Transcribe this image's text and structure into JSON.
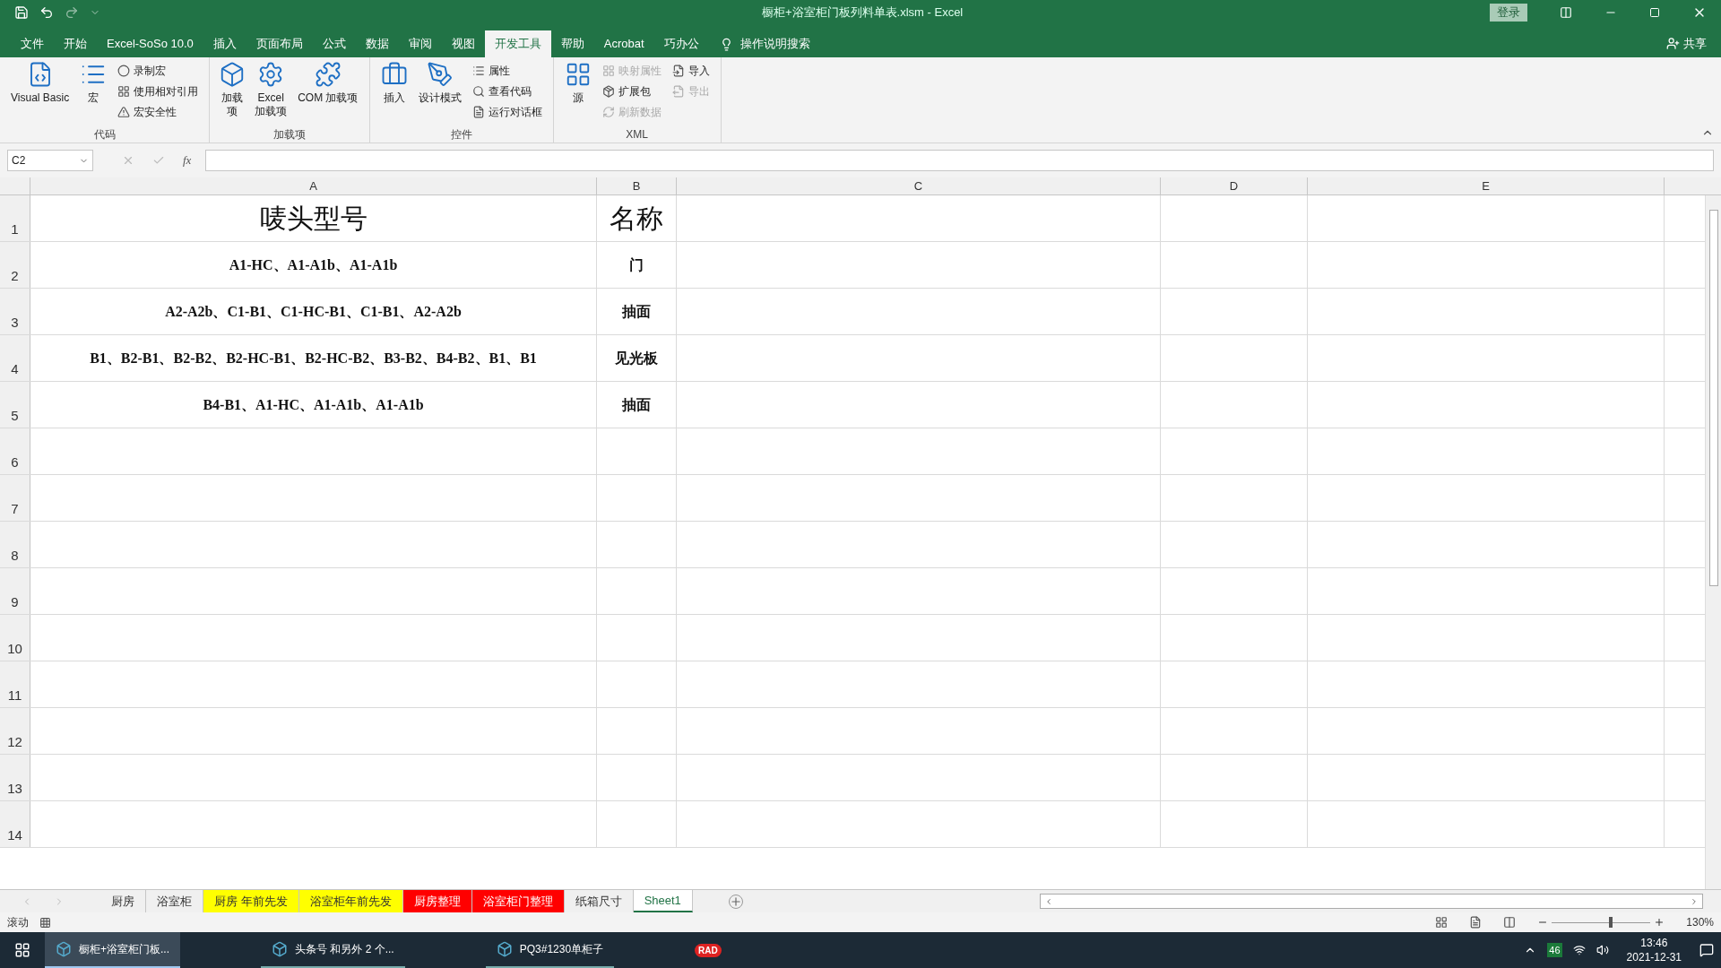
{
  "window": {
    "title": "橱柜+浴室柜门板列料单表.xlsm  -  Excel",
    "login": "登录"
  },
  "menu_tabs": [
    {
      "label": "文件",
      "selected": false
    },
    {
      "label": "开始",
      "selected": false
    },
    {
      "label": "Excel-SoSo 10.0",
      "selected": false
    },
    {
      "label": "插入",
      "selected": false
    },
    {
      "label": "页面布局",
      "selected": false
    },
    {
      "label": "公式",
      "selected": false
    },
    {
      "label": "数据",
      "selected": false
    },
    {
      "label": "审阅",
      "selected": false
    },
    {
      "label": "视图",
      "selected": false
    },
    {
      "label": "开发工具",
      "selected": true
    },
    {
      "label": "帮助",
      "selected": false
    },
    {
      "label": "Acrobat",
      "selected": false
    },
    {
      "label": "巧办公",
      "selected": false
    }
  ],
  "tell_me": "操作说明搜索",
  "share": "共享",
  "ribbon_groups": [
    {
      "label": "代码",
      "items": [
        {
          "kind": "large",
          "label": "Visual Basic",
          "disabled": false
        },
        {
          "kind": "large",
          "label": "宏",
          "disabled": false
        },
        {
          "kind": "small",
          "label": "录制宏",
          "disabled": false
        },
        {
          "kind": "small",
          "label": "使用相对引用",
          "disabled": false
        },
        {
          "kind": "small",
          "label": "宏安全性",
          "disabled": false
        }
      ]
    },
    {
      "label": "加载项",
      "items": [
        {
          "kind": "large",
          "label": "加载项",
          "disabled": false
        },
        {
          "kind": "large",
          "label": "Excel\n加载项",
          "disabled": false
        },
        {
          "kind": "large",
          "label": "COM 加载项",
          "disabled": false
        }
      ]
    },
    {
      "label": "控件",
      "items": [
        {
          "kind": "large",
          "label": "插入",
          "disabled": false
        },
        {
          "kind": "large",
          "label": "设计模式",
          "disabled": false
        },
        {
          "kind": "small",
          "label": "属性",
          "disabled": false
        },
        {
          "kind": "small",
          "label": "查看代码",
          "disabled": false
        },
        {
          "kind": "small",
          "label": "运行对话框",
          "disabled": false
        }
      ]
    },
    {
      "label": "XML",
      "items": [
        {
          "kind": "large",
          "label": "源",
          "disabled": false
        },
        {
          "kind": "small",
          "label": "映射属性",
          "disabled": true
        },
        {
          "kind": "small",
          "label": "扩展包",
          "disabled": false
        },
        {
          "kind": "small",
          "label": "刷新数据",
          "disabled": true
        },
        {
          "kind": "small",
          "label": "导入",
          "disabled": false
        },
        {
          "kind": "small",
          "label": "导出",
          "disabled": true
        }
      ]
    }
  ],
  "name_box": "C2",
  "formula_label": "fx",
  "columns": [
    "A",
    "B",
    "C",
    "D",
    "E"
  ],
  "rows": [
    {
      "number": "1",
      "cells": [
        "唛头型号",
        "名称"
      ]
    },
    {
      "number": "2",
      "cells": [
        "A1-HC、A1-A1b、A1-A1b",
        "门"
      ]
    },
    {
      "number": "3",
      "cells": [
        "A2-A2b、C1-B1、C1-HC-B1、C1-B1、A2-A2b",
        "抽面"
      ]
    },
    {
      "number": "4",
      "cells": [
        "B1、B2-B1、B2-B2、B2-HC-B1、B2-HC-B2、B3-B2、B4-B2、B1、B1",
        "见光板"
      ]
    },
    {
      "number": "5",
      "cells": [
        "B4-B1、A1-HC、A1-A1b、A1-A1b",
        "抽面"
      ]
    },
    {
      "number": "6",
      "cells": []
    },
    {
      "number": "7",
      "cells": []
    },
    {
      "number": "8",
      "cells": []
    },
    {
      "number": "9",
      "cells": []
    },
    {
      "number": "10",
      "cells": []
    },
    {
      "number": "11",
      "cells": []
    },
    {
      "number": "12",
      "cells": []
    },
    {
      "number": "13",
      "cells": []
    },
    {
      "number": "14",
      "cells": []
    }
  ],
  "sheet_tabs": [
    {
      "label": "厨房",
      "color": "#f0f0f0",
      "selected": false
    },
    {
      "label": "浴室柜",
      "color": "#f0f0f0",
      "selected": false
    },
    {
      "label": "厨房 年前先发",
      "color": "#ffff00",
      "selected": false
    },
    {
      "label": "浴室柜年前先发",
      "color": "#ffff00",
      "selected": false
    },
    {
      "label": "厨房整理",
      "color": "#ff0000",
      "selected": false
    },
    {
      "label": "浴室柜门整理",
      "color": "#ff0000",
      "selected": false
    },
    {
      "label": "纸箱尺寸",
      "color": "#f0f0f0",
      "selected": false
    },
    {
      "label": "Sheet1",
      "color": "#ffffff",
      "selected": true
    }
  ],
  "status_bar": {
    "mode": "滚动",
    "zoom": "130%",
    "level": 0.6
  },
  "taskbar": {
    "apps": [
      {
        "label": "橱柜+浴室柜门板...",
        "active": true
      },
      {
        "label": "头条号 和另外 2 个...",
        "active": false
      },
      {
        "label": "PQ3#1230单柜子",
        "active": false
      }
    ],
    "tray_badge": "46",
    "tray_label": "RAD",
    "time": "13:46",
    "date": "2021-12-31"
  }
}
